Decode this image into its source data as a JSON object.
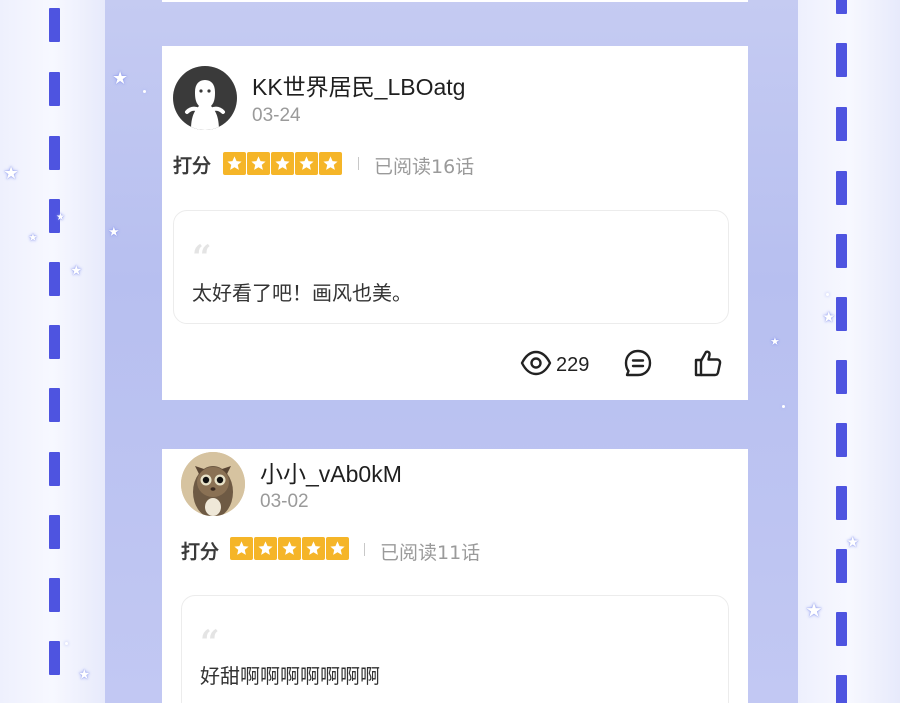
{
  "comments": [
    {
      "username": "KK世界居民_LBOatg",
      "date": "03-24",
      "score_label": "打分",
      "rating": 5,
      "read_text": "已阅读16话",
      "comment": "太好看了吧！画风也美。",
      "views": "229",
      "avatar_icon": "ghost-avatar-icon"
    },
    {
      "username": "小小_vAb0kM",
      "date": "03-02",
      "score_label": "打分",
      "rating": 5,
      "read_text": "已阅读11话",
      "comment": "好甜啊啊啊啊啊啊啊",
      "avatar_icon": "cat-avatar-icon"
    }
  ],
  "colors": {
    "accent_star": "#f5b528",
    "film_hole": "#4e54e0",
    "background": "#c1c8f2"
  }
}
